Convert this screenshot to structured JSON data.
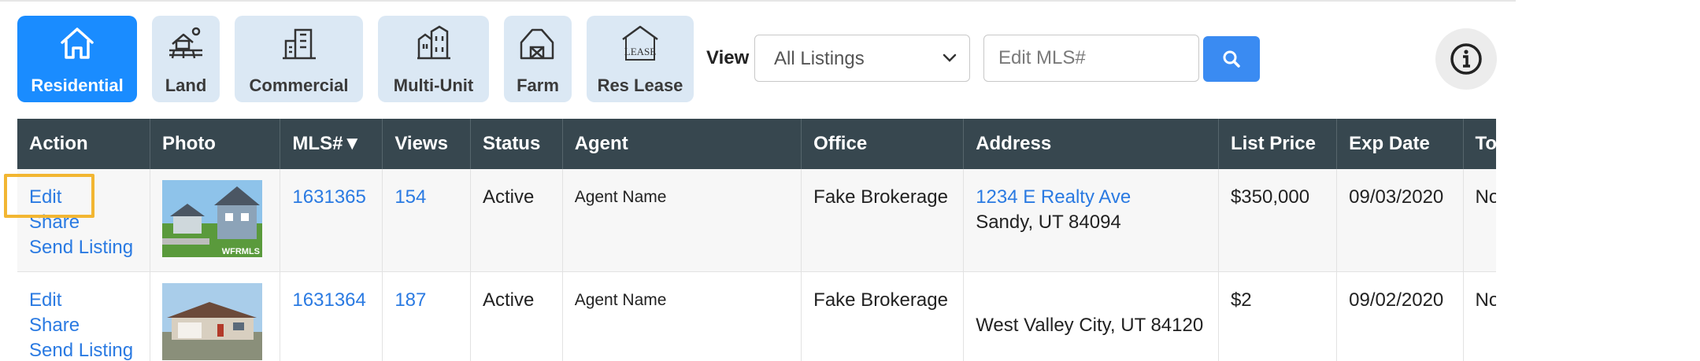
{
  "property_types": [
    {
      "label": "Residential",
      "icon": "house-icon",
      "active": true
    },
    {
      "label": "Land",
      "icon": "land-icon",
      "active": false
    },
    {
      "label": "Commercial",
      "icon": "commercial-building-icon",
      "active": false
    },
    {
      "label": "Multi-Unit",
      "icon": "multi-unit-building-icon",
      "active": false
    },
    {
      "label": "Farm",
      "icon": "farm-icon",
      "active": false
    },
    {
      "label": "Res Lease",
      "icon": "lease-house-icon",
      "active": false
    }
  ],
  "filters": {
    "view_label": "View",
    "view_selected": "All Listings",
    "mls_placeholder": "Edit MLS#",
    "search_icon": "search-icon",
    "info_icon": "info-icon"
  },
  "table": {
    "columns": [
      "Action",
      "Photo",
      "MLS#▼",
      "Views",
      "Status",
      "Agent",
      "Office",
      "Address",
      "List Price",
      "Exp Date",
      "Tour"
    ],
    "rows": [
      {
        "actions": [
          "Edit",
          "Share",
          "Send Listing"
        ],
        "photo": "house-photo-1",
        "mls": "1631365",
        "views": "154",
        "status": "Active",
        "agent": "Agent Name",
        "office": "Fake Brokerage",
        "address_line1": "1234 E Realty Ave",
        "address_line2": "Sandy, UT 84094",
        "price": "$350,000",
        "exp_date": "09/03/2020",
        "tour": "None"
      },
      {
        "actions": [
          "Edit",
          "Share",
          "Send Listing"
        ],
        "photo": "house-photo-2",
        "mls": "1631364",
        "views": "187",
        "status": "Active",
        "agent": "Agent Name",
        "office": "Fake Brokerage",
        "address_line1": "",
        "address_line2": "West Valley City, UT 84120",
        "price": "$2",
        "exp_date": "09/02/2020",
        "tour": "None"
      }
    ]
  },
  "photo_watermark": "WFRMLS",
  "colors": {
    "active_tab": "#1a8cff",
    "tab": "#dbe8f4",
    "header": "#37474f",
    "link": "#2a7ae2",
    "highlight": "#f2b632"
  }
}
